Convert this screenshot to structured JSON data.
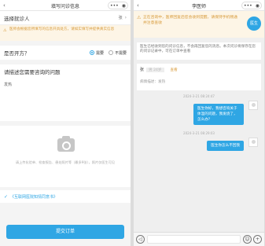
{
  "left": {
    "topbar": {
      "back": "‹",
      "title": "填写问诊信息",
      "cap_more": "•••",
      "cap_close": "◉"
    },
    "patient": {
      "label": "选择就诊人",
      "value": "张",
      "arrow": "›"
    },
    "warning": {
      "icon": "⚠",
      "text": "医师会根据您所填写的信息开具处方，请如实填写并提供真实信息"
    },
    "prescription": {
      "label": "是否开方？",
      "options": [
        "需要",
        "不需要"
      ],
      "selected_index": 0
    },
    "question": {
      "heading": "请描述您需要咨询的问题",
      "answer": "发热"
    },
    "upload": {
      "tip": "请上传化验单、检查报告、患处照片等（最多9张），照片仅医生可见"
    },
    "agree": {
      "check": "✓",
      "text": "《互联网医院知情同意书》"
    },
    "submit_label": "提交订单"
  },
  "right": {
    "topbar": {
      "back": "‹",
      "title": "李医师",
      "cap_more": "•••",
      "cap_close": "◉"
    },
    "notice": {
      "icon": "⚠",
      "text": "正在咨询中，医师回复后您会收到提醒，请保持手机畅通并注意查收"
    },
    "doctor_avatar_label": "医生",
    "system_msg": "医生已经收到您的问诊信息，不会再回复您的消息。本次问诊将保存在您的问诊记录中，可在订单中查看",
    "card": {
      "name": "张",
      "badge": "男 24岁",
      "link": "查看",
      "desc": "病情描述：发热"
    },
    "messages": [
      {
        "time": "2024-3-21 08:24:47",
        "text": "医生你好，我想咨询关于体温的问题，我发烧了，怎么办？"
      },
      {
        "time": "2024-3-21 08:29:03",
        "text": "医生你怎么不回我"
      }
    ],
    "input": {
      "voice": "◁",
      "emoji": "☺",
      "plus": "+"
    }
  }
}
